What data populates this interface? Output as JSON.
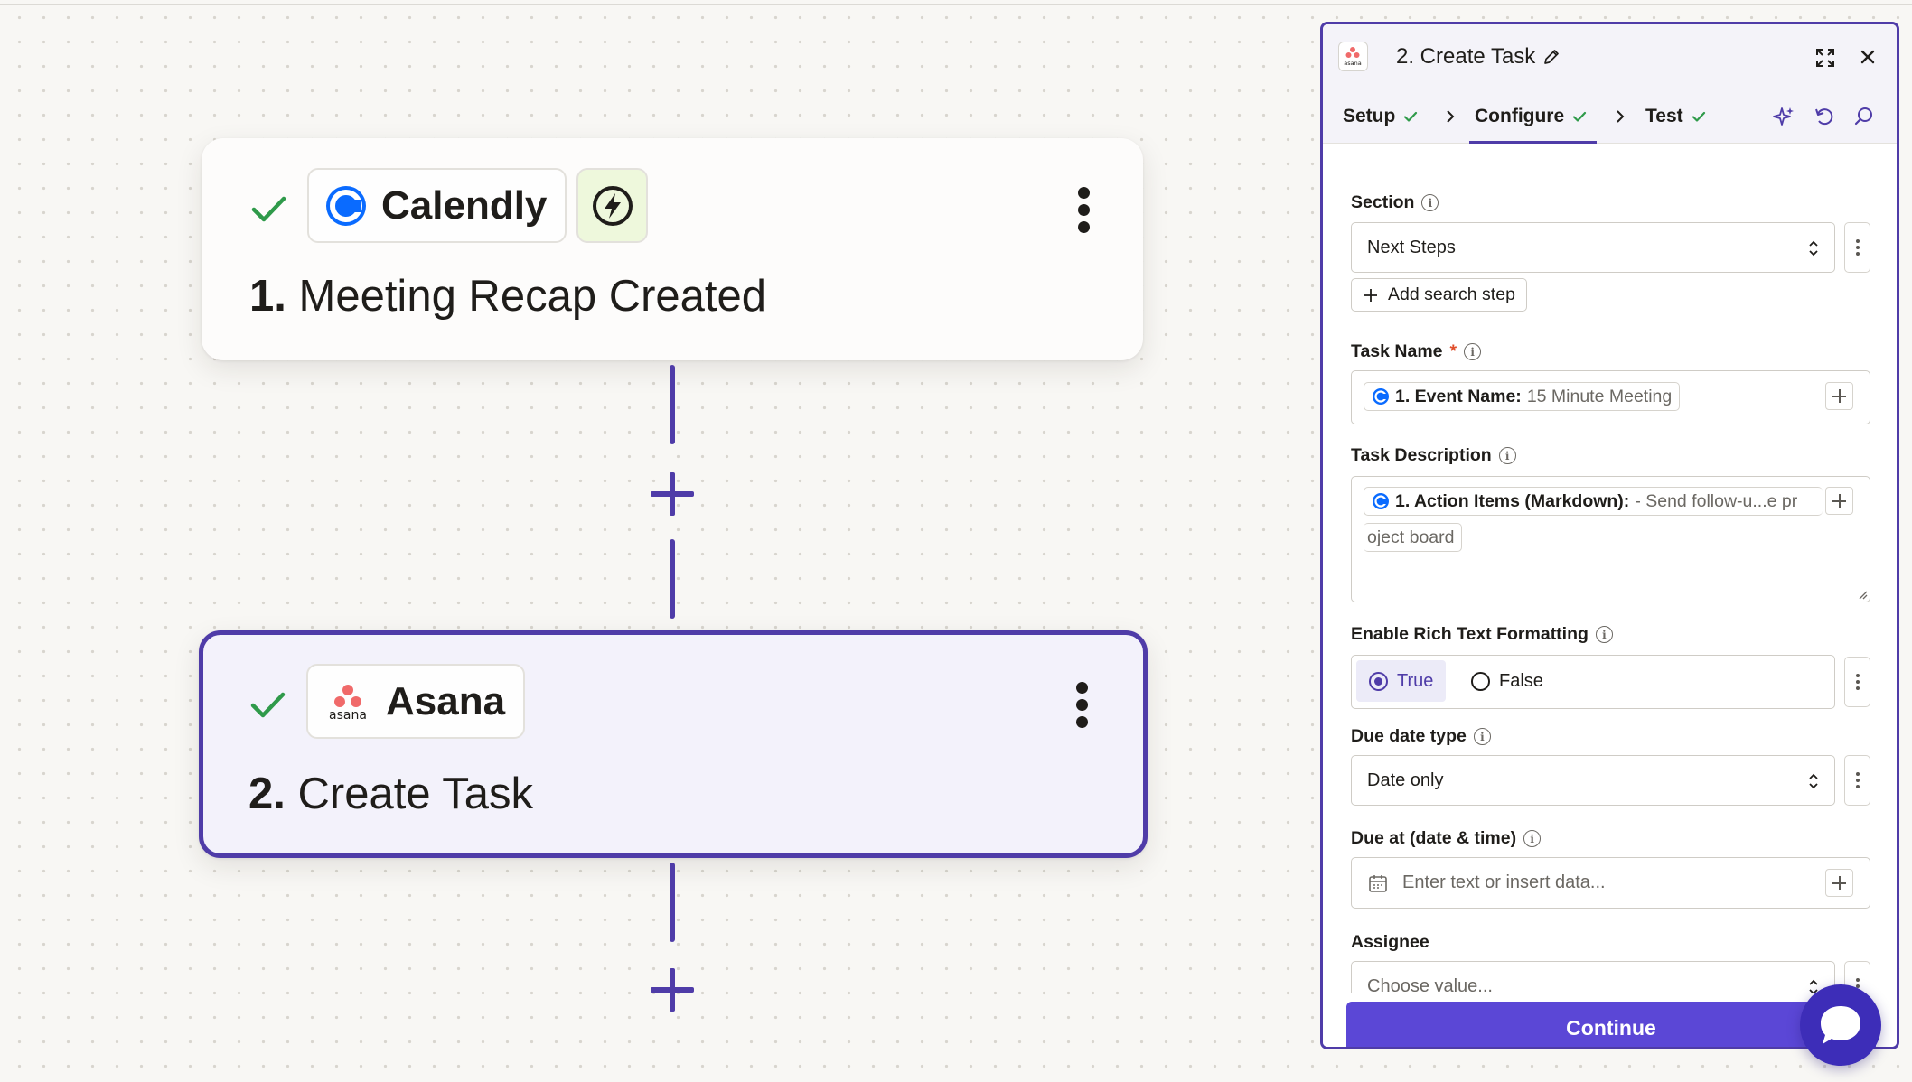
{
  "canvas": {
    "steps": [
      {
        "app": "Calendly",
        "number": "1.",
        "title": "Meeting Recap Created",
        "status": "complete",
        "has_trigger_badge": true
      },
      {
        "app": "Asana",
        "number": "2.",
        "title": "Create Task",
        "status": "complete",
        "selected": true
      }
    ]
  },
  "panel": {
    "logo_text": "asana",
    "title": "2. Create Task",
    "tabs": [
      {
        "label": "Setup",
        "complete": true
      },
      {
        "label": "Configure",
        "complete": true,
        "active": true
      },
      {
        "label": "Test",
        "complete": true
      }
    ],
    "fields": {
      "section": {
        "label": "Section",
        "value": "Next Steps"
      },
      "add_search_step": "Add search step",
      "task_name": {
        "label": "Task Name",
        "required_mark": "*",
        "pill_label": "1. Event Name:",
        "pill_value": "15 Minute Meeting"
      },
      "task_description": {
        "label": "Task Description",
        "pill_label": "1. Action Items (Markdown):",
        "pill_value": "- Send follow-u...e pr",
        "pill_wrap": "oject board"
      },
      "rich_text": {
        "label": "Enable Rich Text Formatting",
        "options": [
          "True",
          "False"
        ],
        "selected": "True"
      },
      "due_date_type": {
        "label": "Due date type",
        "value": "Date only"
      },
      "due_at": {
        "label": "Due at (date & time)",
        "placeholder": "Enter text or insert data..."
      },
      "assignee": {
        "label": "Assignee",
        "placeholder": "Choose value..."
      }
    },
    "continue_label": "Continue"
  },
  "colors": {
    "accent": "#4f3ca8",
    "button": "#5b47d6",
    "success": "#2f9a4a",
    "required": "#e04e2b",
    "calendly_blue": "#0a6bff",
    "asana_coral": "#f06a6a"
  },
  "icons": [
    "check-icon",
    "calendly-logo",
    "lightning-icon",
    "kebab-icon",
    "asana-logo",
    "plus-icon",
    "pencil-icon",
    "expand-icon",
    "close-icon",
    "chevron-right-icon",
    "sparkle-icon",
    "undo-icon",
    "search-icon",
    "info-icon",
    "updown-icon",
    "calendar-icon",
    "chat-icon"
  ]
}
